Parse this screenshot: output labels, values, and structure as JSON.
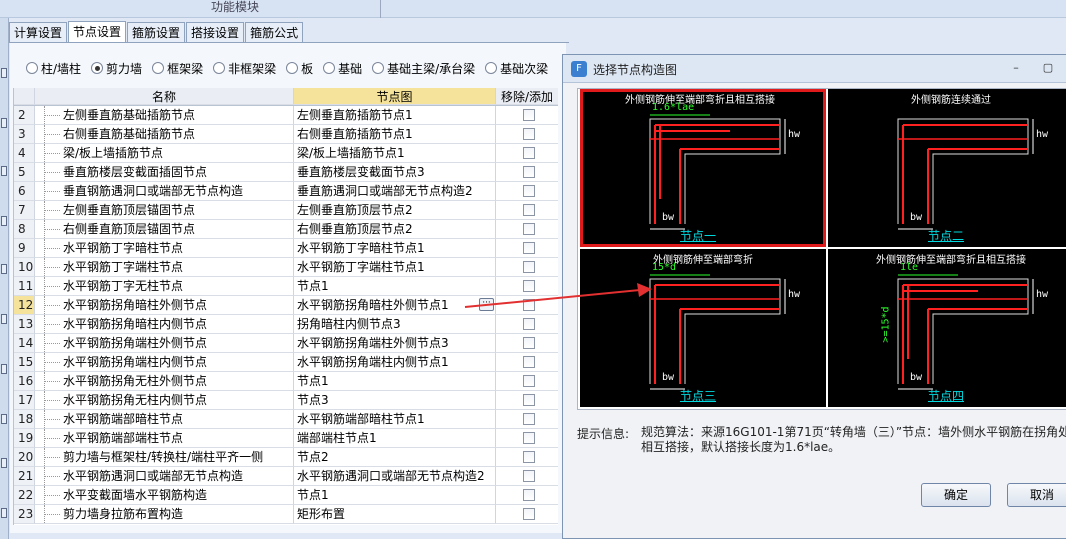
{
  "window": {
    "module_title": "功能模块"
  },
  "tabs": [
    {
      "label": "计算设置",
      "active": false
    },
    {
      "label": "节点设置",
      "active": true
    },
    {
      "label": "箍筋设置",
      "active": false
    },
    {
      "label": "搭接设置",
      "active": false
    },
    {
      "label": "箍筋公式",
      "active": false
    }
  ],
  "categories": [
    {
      "label": "柱/墙柱",
      "selected": false
    },
    {
      "label": "剪力墙",
      "selected": true
    },
    {
      "label": "框架梁",
      "selected": false
    },
    {
      "label": "非框架梁",
      "selected": false
    },
    {
      "label": "板",
      "selected": false
    },
    {
      "label": "基础",
      "selected": false
    },
    {
      "label": "基础主梁/承台梁",
      "selected": false
    },
    {
      "label": "基础次梁",
      "selected": false
    }
  ],
  "table": {
    "headers": {
      "name": "名称",
      "node": "节点图",
      "toggle": "移除/添加"
    },
    "rows": [
      {
        "no": "2",
        "name": "左侧垂直筋基础插筋节点",
        "node": "左侧垂直筋插筋节点1"
      },
      {
        "no": "3",
        "name": "右侧垂直筋基础插筋节点",
        "node": "右侧垂直筋插筋节点1"
      },
      {
        "no": "4",
        "name": "梁/板上墙插筋节点",
        "node": "梁/板上墙插筋节点1"
      },
      {
        "no": "5",
        "name": "垂直筋楼层变截面插固节点",
        "node": "垂直筋楼层变截面节点3"
      },
      {
        "no": "6",
        "name": "垂直钢筋遇洞口或端部无节点构造",
        "node": "垂直筋遇洞口或端部无节点构造2"
      },
      {
        "no": "7",
        "name": "左侧垂直筋顶层锚固节点",
        "node": "左侧垂直筋顶层节点2"
      },
      {
        "no": "8",
        "name": "右侧垂直筋顶层锚固节点",
        "node": "右侧垂直筋顶层节点2"
      },
      {
        "no": "9",
        "name": "水平钢筋丁字暗柱节点",
        "node": "水平钢筋丁字暗柱节点1"
      },
      {
        "no": "10",
        "name": "水平钢筋丁字端柱节点",
        "node": "水平钢筋丁字端柱节点1"
      },
      {
        "no": "11",
        "name": "水平钢筋丁字无柱节点",
        "node": "节点1"
      },
      {
        "no": "12",
        "name": "水平钢筋拐角暗柱外侧节点",
        "node": "水平钢筋拐角暗柱外侧节点1",
        "selected": true
      },
      {
        "no": "13",
        "name": "水平钢筋拐角暗柱内侧节点",
        "node": "拐角暗柱内侧节点3"
      },
      {
        "no": "14",
        "name": "水平钢筋拐角端柱外侧节点",
        "node": "水平钢筋拐角端柱外侧节点3"
      },
      {
        "no": "15",
        "name": "水平钢筋拐角端柱内侧节点",
        "node": "水平钢筋拐角端柱内侧节点1"
      },
      {
        "no": "16",
        "name": "水平钢筋拐角无柱外侧节点",
        "node": "节点1"
      },
      {
        "no": "17",
        "name": "水平钢筋拐角无柱内侧节点",
        "node": "节点3"
      },
      {
        "no": "18",
        "name": "水平钢筋端部暗柱节点",
        "node": "水平钢筋端部暗柱节点1"
      },
      {
        "no": "19",
        "name": "水平钢筋端部端柱节点",
        "node": "端部端柱节点1"
      },
      {
        "no": "20",
        "name": "剪力墙与框架柱/转换柱/端柱平齐一侧",
        "node": "节点2"
      },
      {
        "no": "21",
        "name": "水平钢筋遇洞口或端部无节点构造",
        "node": "水平钢筋遇洞口或端部无节点构造2"
      },
      {
        "no": "22",
        "name": "水平变截面墙水平钢筋构造",
        "node": "节点1"
      },
      {
        "no": "23",
        "name": "剪力墙身拉筋布置构造",
        "node": "矩形布置"
      }
    ]
  },
  "dialog": {
    "title": "选择节点构造图",
    "minimize": "–",
    "maximize": "▢",
    "nodes": [
      {
        "title": "外侧钢筋伸至端部弯折且相互搭接",
        "annotation": "1.6*lae",
        "label": "节点一",
        "selected": true
      },
      {
        "title": "外侧钢筋连续通过",
        "annotation": "",
        "label": "节点二",
        "selected": false
      },
      {
        "title": "外侧钢筋伸至端部弯折",
        "annotation": "15*d",
        "label": "节点三",
        "selected": false
      },
      {
        "title": "外侧钢筋伸至端部弯折且相互搭接",
        "annotation": "1le",
        "vertical_annotation": ">=15*d",
        "label": "节点四",
        "selected": false
      }
    ],
    "dim_labels": {
      "bw": "bw",
      "hw": "hw"
    },
    "hint_label": "提示信息:",
    "hint_text": "规范算法：来源16G101-1第71页“转角墙（三）”节点：墙外侧水平钢筋在拐角处相互搭接，默认搭接长度为1.6*lae。",
    "ok": "确定",
    "cancel": "取消"
  },
  "colors": {
    "selection": "#f6e39b",
    "node_border": "#e01a1a",
    "rebar": "#ff2020",
    "annotation": "#2aff2a"
  },
  "icons": [
    "radio-icon",
    "ellipsis-icon",
    "app-icon",
    "minimize-icon",
    "maximize-icon"
  ]
}
